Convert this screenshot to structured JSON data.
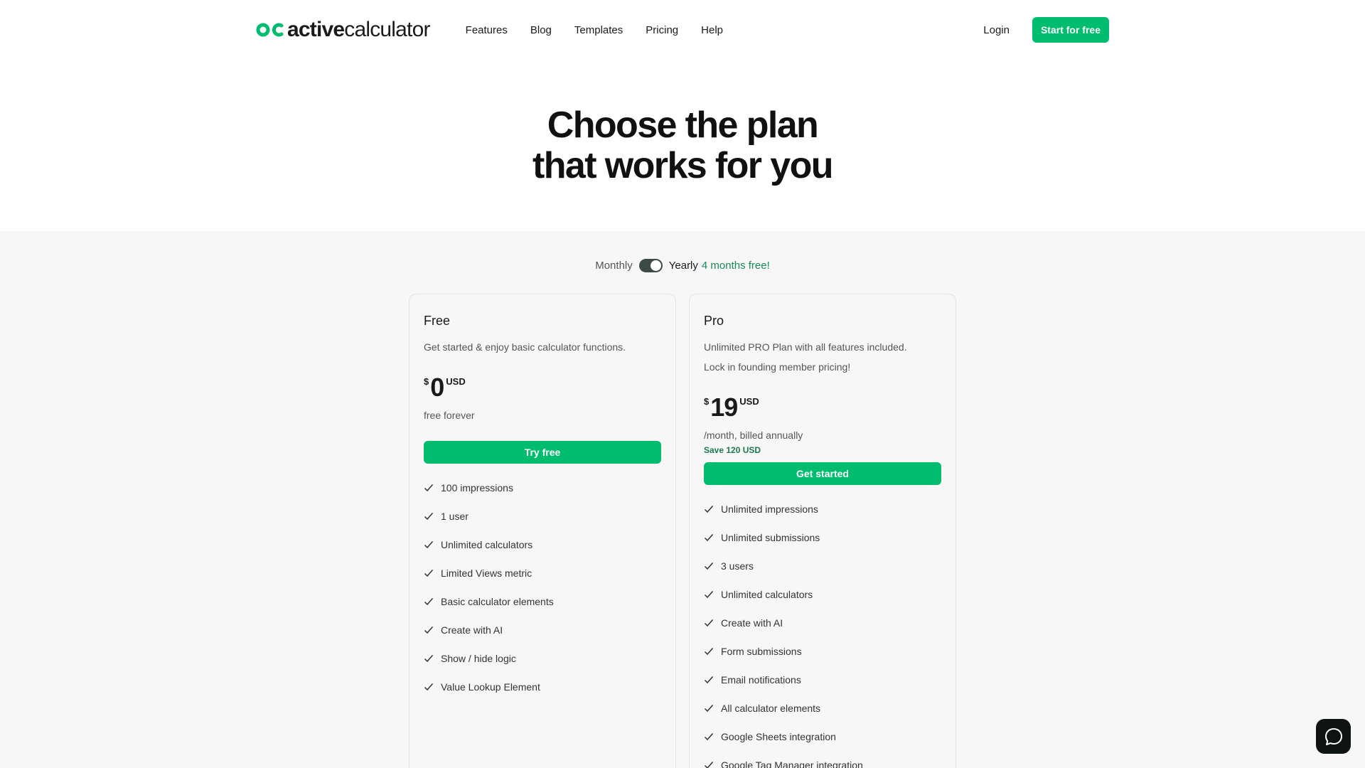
{
  "brand": {
    "name_bold": "active",
    "name_light": "calculator",
    "accent": "#00bc6e"
  },
  "nav": [
    {
      "label": "Features"
    },
    {
      "label": "Blog"
    },
    {
      "label": "Templates"
    },
    {
      "label": "Pricing"
    },
    {
      "label": "Help"
    }
  ],
  "header": {
    "login_label": "Login",
    "cta_label": "Start for free"
  },
  "hero": {
    "line1": "Choose the plan",
    "line2": "that works for you"
  },
  "billing": {
    "monthly_label": "Monthly",
    "yearly_label": "Yearly",
    "promo": "4 months free!",
    "selected": "Yearly"
  },
  "plans": [
    {
      "name": "Free",
      "description": [
        "Get started & enjoy basic calculator functions."
      ],
      "currency_symbol": "$",
      "amount": "0",
      "currency_code": "USD",
      "period": "free forever",
      "button_label": "Try free",
      "features": [
        "100 impressions",
        "1 user",
        "Unlimited calculators",
        "Limited Views metric",
        "Basic calculator elements",
        "Create with AI",
        "Show / hide logic",
        "Value Lookup Element"
      ]
    },
    {
      "name": "Pro",
      "description": [
        "Unlimited PRO Plan with all features included.",
        "Lock in founding member pricing!"
      ],
      "currency_symbol": "$",
      "amount": "19",
      "currency_code": "USD",
      "period": "/month, billed annually",
      "savings": "Save 120 USD",
      "button_label": "Get started",
      "features": [
        "Unlimited impressions",
        "Unlimited submissions",
        "3 users",
        "Unlimited calculators",
        "Create with AI",
        "Form submissions",
        "Email notifications",
        "All calculator elements",
        "Google Sheets integration",
        "Google Tag Manager integration"
      ]
    }
  ],
  "icons": {
    "check": "check-icon",
    "chat": "chat-icon"
  }
}
